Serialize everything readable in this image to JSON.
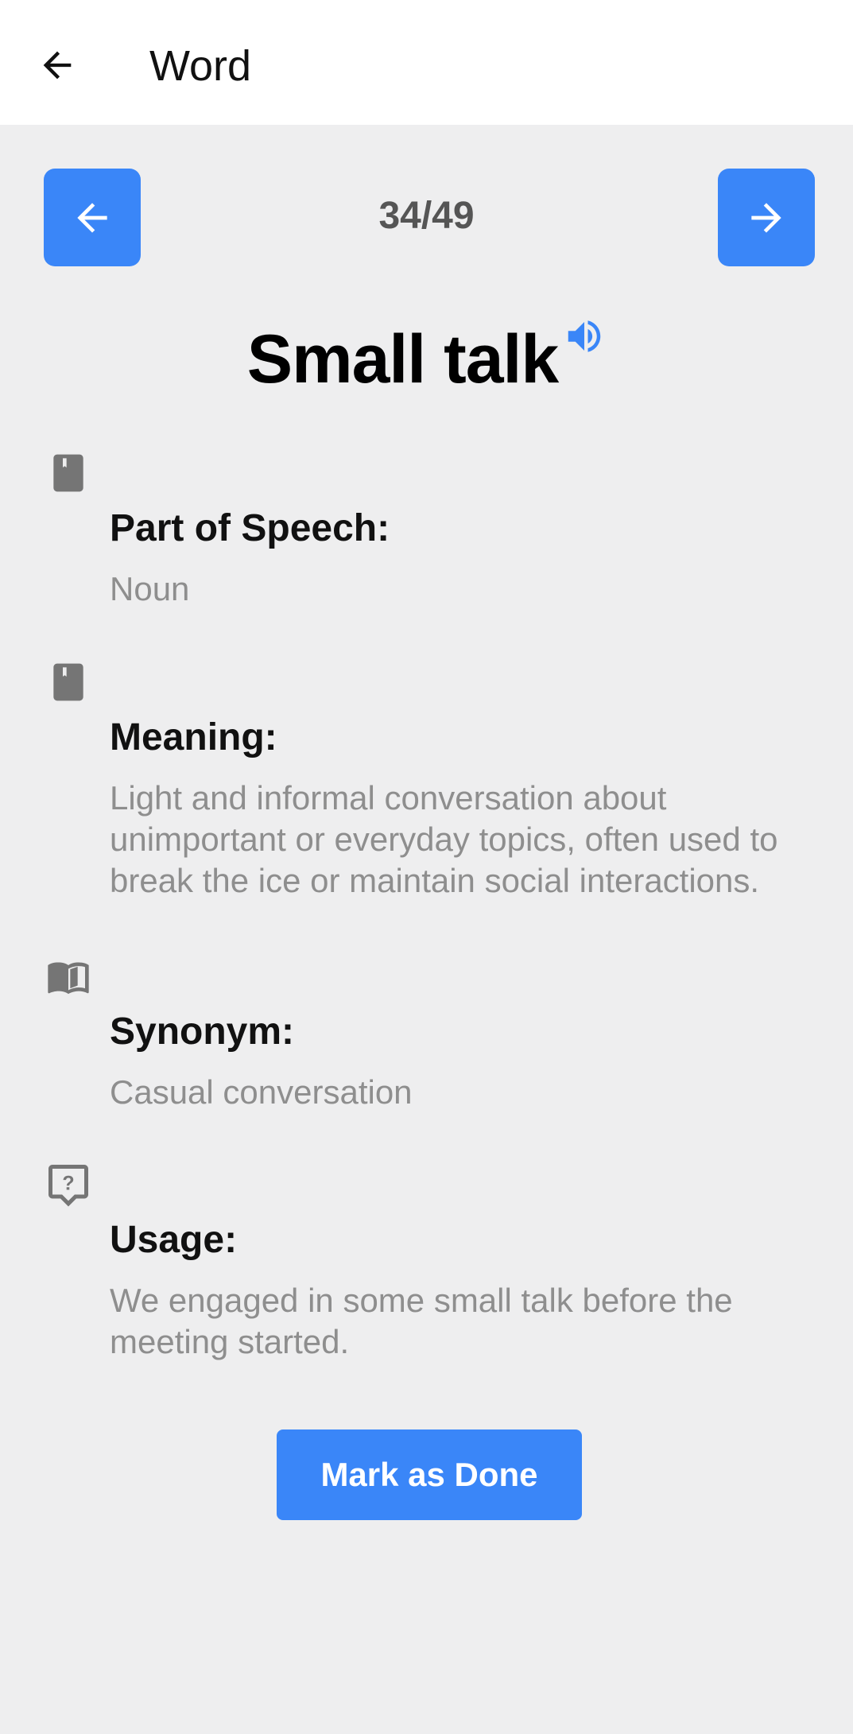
{
  "appbar": {
    "title": "Word"
  },
  "nav": {
    "counter": "34/49"
  },
  "word": {
    "text": "Small talk"
  },
  "sections": [
    {
      "icon": "book-icon",
      "label": "Part of Speech:",
      "value": "Noun"
    },
    {
      "icon": "book-icon",
      "label": "Meaning:",
      "value": "Light and informal conversation about unimportant or everyday topics, often used to break the ice or maintain social interactions."
    },
    {
      "icon": "open-book-icon",
      "label": "Synonym:",
      "value": "Casual conversation"
    },
    {
      "icon": "question-bubble-icon",
      "label": "Usage:",
      "value": "We engaged in some small talk before the meeting started."
    }
  ],
  "actions": {
    "done_label": "Mark as Done"
  },
  "colors": {
    "accent": "#3a86f8",
    "background": "#eeeeef",
    "icon": "#757575",
    "muted_text": "#8e8e8e"
  }
}
